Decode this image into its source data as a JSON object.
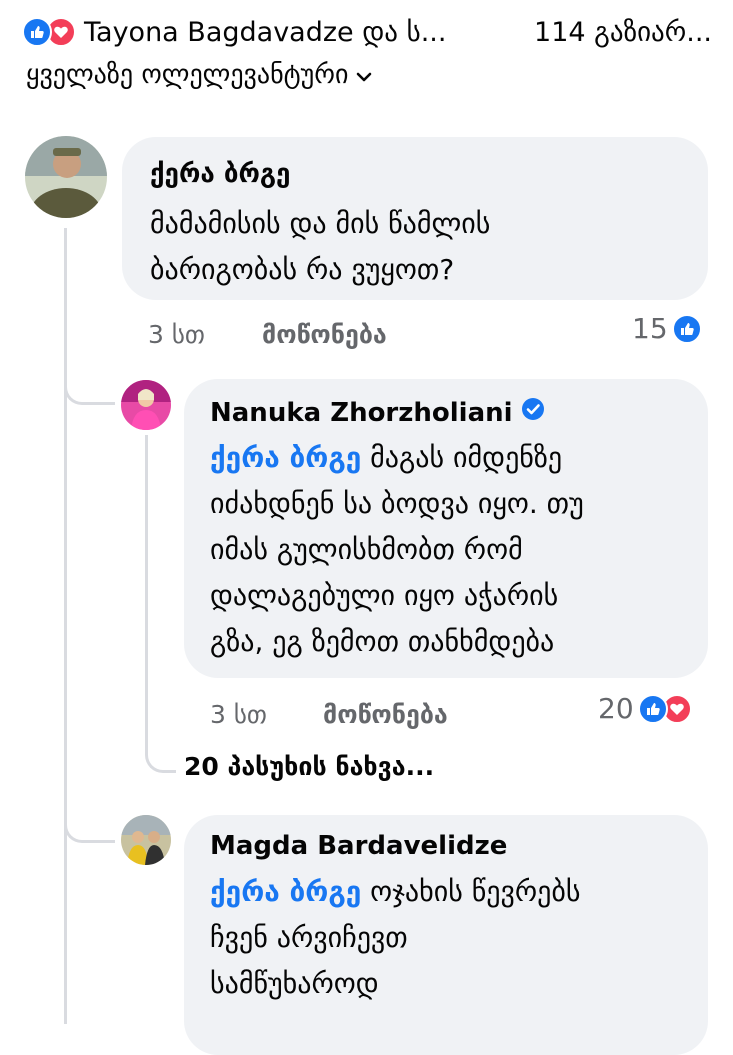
{
  "header": {
    "reactors": "Tayona Bagdavadze და ს...",
    "shares": "114 გაზიარ...",
    "sort_label": "ყველაზე ოლელევანტური"
  },
  "comments": [
    {
      "author": "ქერა ბრგე",
      "text": [
        "მამამისის და მის წამლის",
        "ბარიგობას რა ვუყოთ?"
      ],
      "time": "3 სთ",
      "like_label": "მოწონება",
      "reactions_count": "15"
    },
    {
      "author": "Nanuka Zhorzholiani",
      "mention": "ქერა ბრგე",
      "text": [
        " მაგას იმდენზე",
        "იძახდნენ სა ბოდვა იყო. თუ",
        "იმას გულისხმობთ რომ",
        "დალაგებული იყო აჭარის",
        "გზა, ეგ ზემოთ თანხმდება"
      ],
      "time": "3 სთ",
      "like_label": "მოწონება",
      "reactions_count": "20"
    },
    {
      "author": "Magda Bardavelidze",
      "mention": "ქერა ბრგე",
      "text": [
        " ოჯახის წევრებს",
        "ჩვენ არვიჩევთ",
        "სამწუხაროდ"
      ]
    }
  ],
  "view_replies": "20 პასუხის ნახვა...",
  "colors": {
    "like_blue": "#1877f2",
    "love_red": "#f33e58",
    "bubble": "#f0f2f5",
    "muted": "#65676b"
  }
}
